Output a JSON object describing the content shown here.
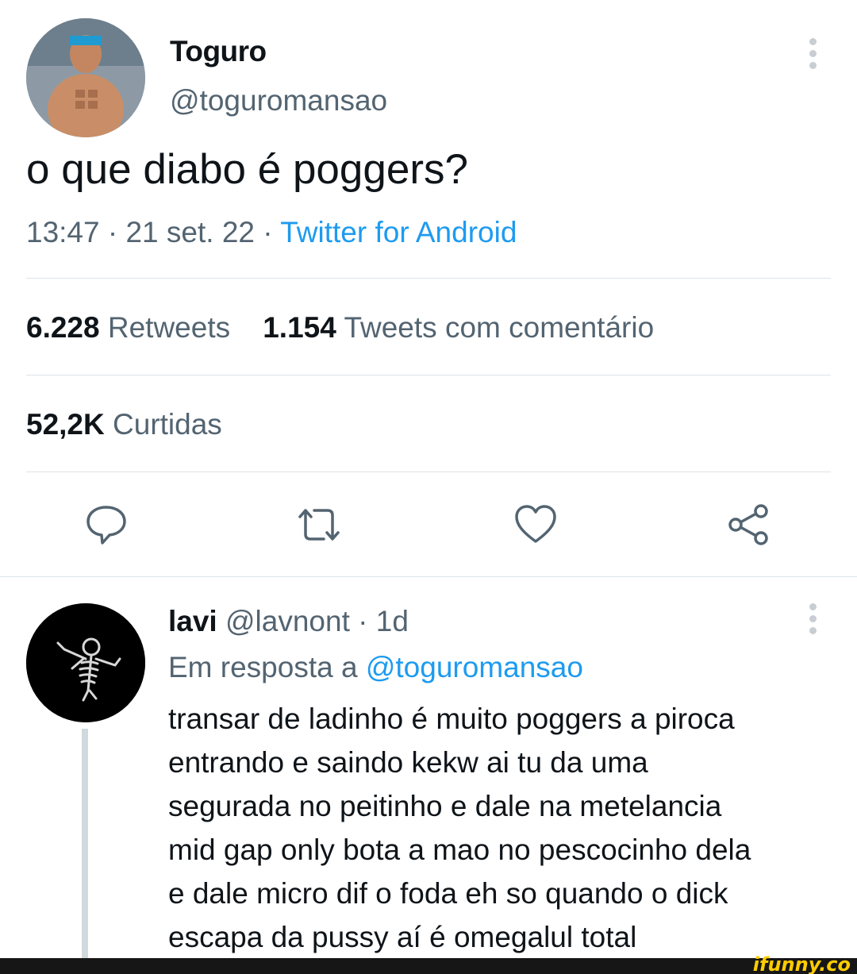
{
  "tweet": {
    "author_name": "Toguro",
    "author_handle": "@toguromansao",
    "text": "o que diabo é poggers?",
    "time": "13:47",
    "date": "21 set. 22",
    "source": "Twitter for Android",
    "separator": " · ",
    "retweets_count": "6.228",
    "retweets_label": "Retweets",
    "quotes_count": "1.154",
    "quotes_label": "Tweets com comentário",
    "likes_count": "52,2K",
    "likes_label": "Curtidas"
  },
  "actions": {
    "reply_icon": "speech-bubble-icon",
    "retweet_icon": "retweet-arrows-icon",
    "like_icon": "heart-icon",
    "share_icon": "share-nodes-icon"
  },
  "reply": {
    "author_name": "lavi",
    "author_handle": "@lavnont",
    "age": "1d",
    "separator": " · ",
    "in_reply_prefix": "Em resposta a",
    "in_reply_mention": "@toguromansao",
    "text_lines": [
      "transar de ladinho é muito poggers a piroca",
      "entrando e saindo kekw ai tu da uma",
      "segurada no peitinho e dale na metelancia",
      "mid gap only bota a mao no pescocinho dela",
      "e dale micro dif o foda eh so quando o dick",
      "escapa da pussy aí é omegalul total"
    ]
  },
  "watermark": "ifunny.co",
  "colors": {
    "text_primary": "#0f1419",
    "text_secondary": "#536471",
    "link": "#1d9bf0",
    "divider": "#dde3e8"
  }
}
